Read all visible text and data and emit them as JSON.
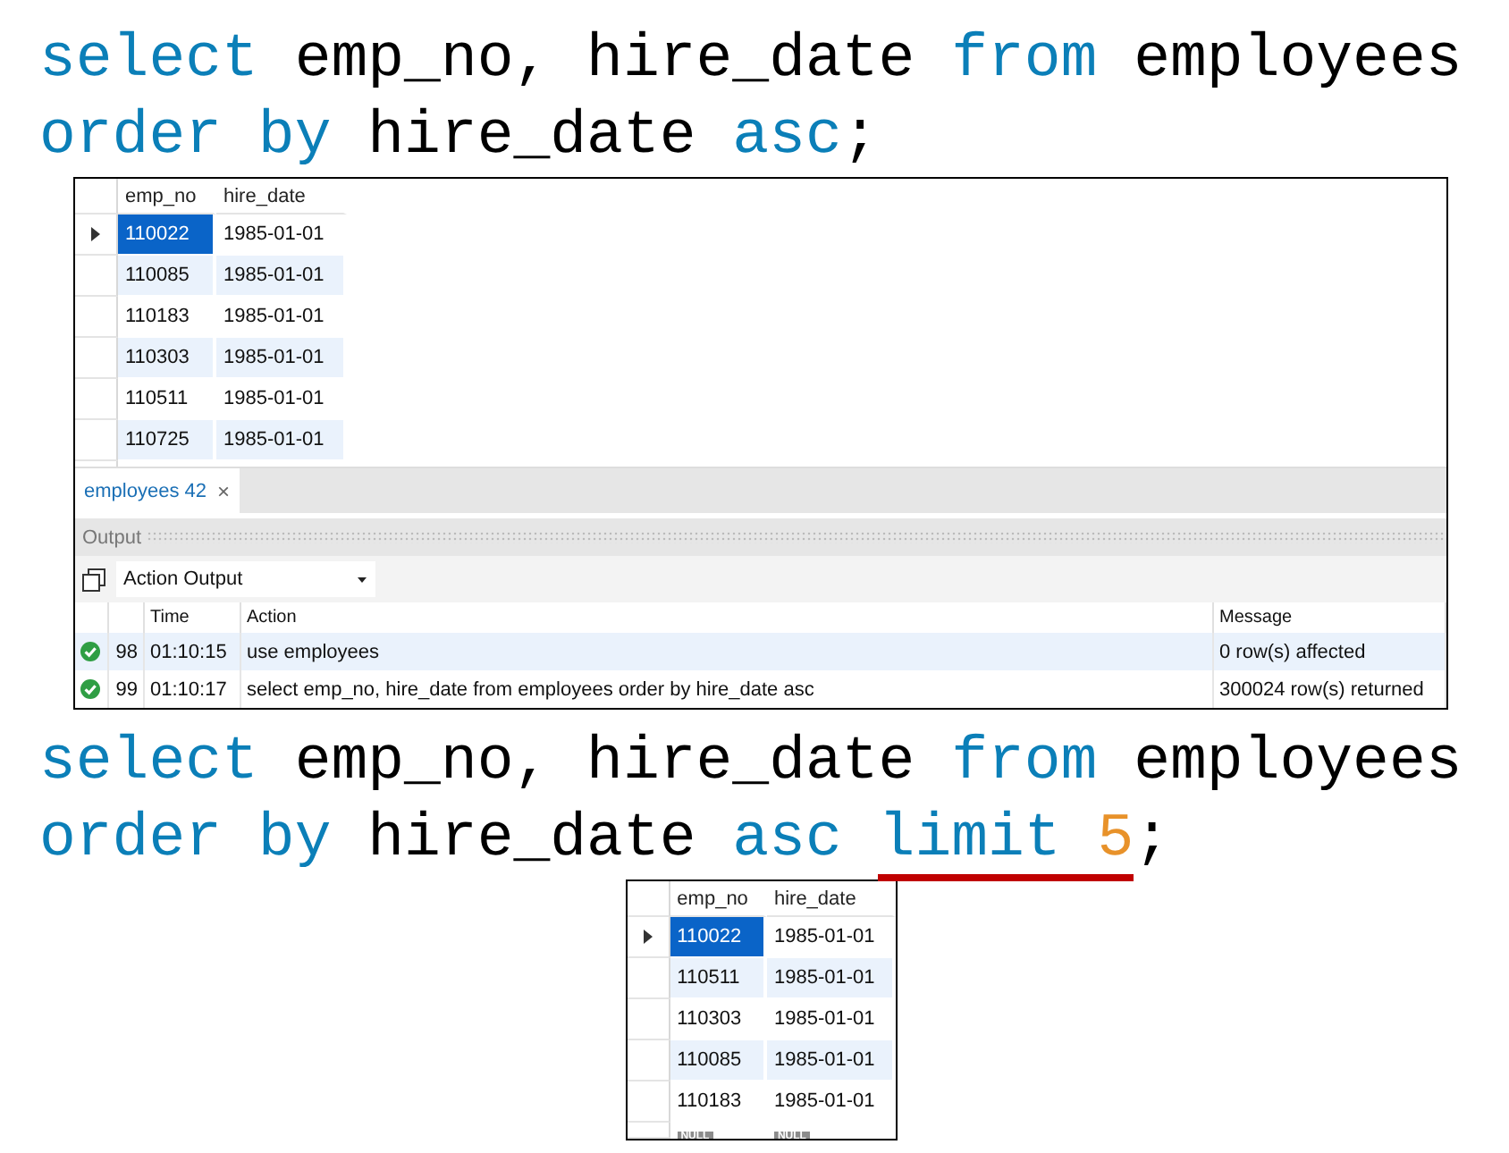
{
  "query_1": {
    "lines": [
      [
        {
          "text": "select",
          "kind": "keyword",
          "underlined": false
        },
        {
          "text": " emp_no, hire_date ",
          "kind": "plain",
          "underlined": false
        },
        {
          "text": "from",
          "kind": "keyword",
          "underlined": false
        },
        {
          "text": " employees",
          "kind": "plain",
          "underlined": false
        }
      ],
      [
        {
          "text": "order by",
          "kind": "keyword",
          "underlined": false
        },
        {
          "text": " hire_date ",
          "kind": "plain",
          "underlined": false
        },
        {
          "text": "asc",
          "kind": "keyword",
          "underlined": false
        },
        {
          "text": ";",
          "kind": "plain",
          "underlined": false
        }
      ]
    ]
  },
  "result_1": {
    "grid": {
      "columns": [
        "emp_no",
        "hire_date"
      ],
      "rows": [
        {
          "cells": [
            "110022",
            "1985-01-01"
          ],
          "selected": true
        },
        {
          "cells": [
            "110085",
            "1985-01-01"
          ],
          "selected": false
        },
        {
          "cells": [
            "110183",
            "1985-01-01"
          ],
          "selected": false
        },
        {
          "cells": [
            "110303",
            "1985-01-01"
          ],
          "selected": false
        },
        {
          "cells": [
            "110511",
            "1985-01-01"
          ],
          "selected": false
        },
        {
          "cells": [
            "110725",
            "1985-01-01"
          ],
          "selected": false
        }
      ]
    },
    "tab": {
      "label": "employees 42",
      "close": "×"
    },
    "output": {
      "title": "Output",
      "dropdown": "Action Output",
      "columns": [
        "Time",
        "Action",
        "Message"
      ],
      "rows": [
        {
          "number": "98",
          "time": "01:10:15",
          "action": "use employees",
          "message": "0 row(s) affected"
        },
        {
          "number": "99",
          "time": "01:10:17",
          "action": "select emp_no, hire_date from employees order by hire_date asc",
          "message": "300024 row(s) returned"
        }
      ]
    }
  },
  "query_2": {
    "lines": [
      [
        {
          "text": "select",
          "kind": "keyword",
          "underlined": false
        },
        {
          "text": " emp_no, hire_date ",
          "kind": "plain",
          "underlined": false
        },
        {
          "text": "from",
          "kind": "keyword",
          "underlined": false
        },
        {
          "text": " employees",
          "kind": "plain",
          "underlined": false
        }
      ],
      [
        {
          "text": "order by",
          "kind": "keyword",
          "underlined": false
        },
        {
          "text": " hire_date ",
          "kind": "plain",
          "underlined": false
        },
        {
          "text": "asc ",
          "kind": "keyword",
          "underlined": false
        },
        {
          "text": "limit ",
          "kind": "keyword",
          "underlined": true
        },
        {
          "text": "5",
          "kind": "number",
          "underlined": true
        },
        {
          "text": ";",
          "kind": "plain",
          "underlined": false
        }
      ]
    ]
  },
  "result_2": {
    "grid": {
      "columns": [
        "emp_no",
        "hire_date"
      ],
      "rows": [
        {
          "cells": [
            "110022",
            "1985-01-01"
          ],
          "selected": true
        },
        {
          "cells": [
            "110511",
            "1985-01-01"
          ],
          "selected": false
        },
        {
          "cells": [
            "110303",
            "1985-01-01"
          ],
          "selected": false
        },
        {
          "cells": [
            "110085",
            "1985-01-01"
          ],
          "selected": false
        },
        {
          "cells": [
            "110183",
            "1985-01-01"
          ],
          "selected": false
        }
      ],
      "null_row": [
        "NULL",
        "NULL"
      ]
    }
  }
}
